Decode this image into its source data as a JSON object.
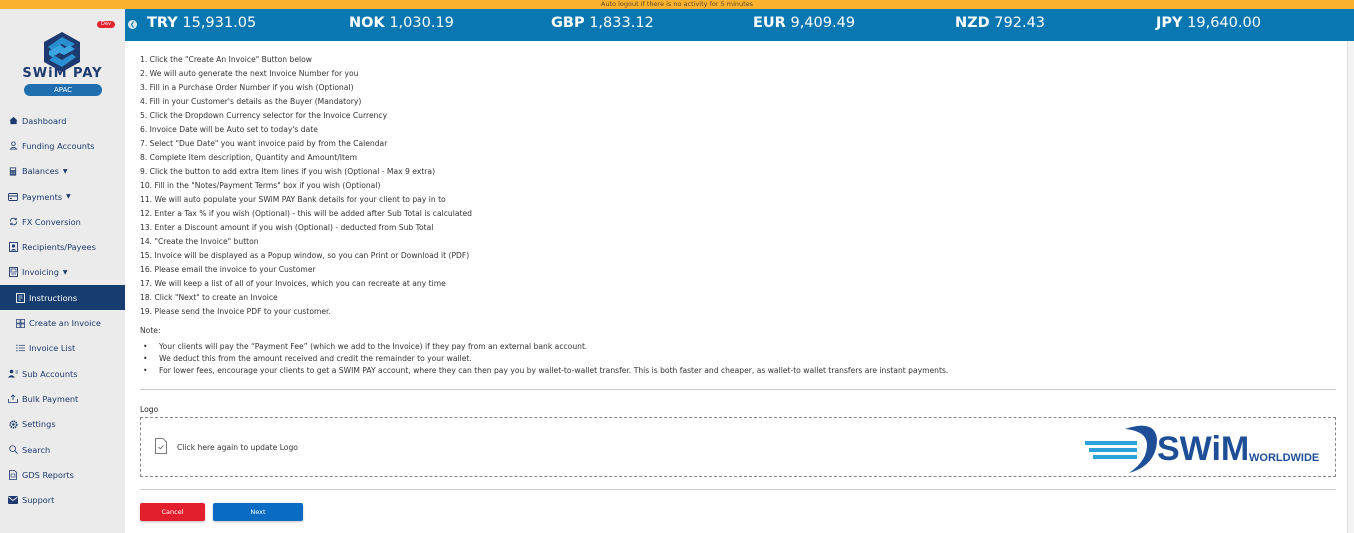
{
  "topbar": {
    "message": "Auto logout if there is no activity for 5 minutes"
  },
  "brand": {
    "name": "SWiM PAY",
    "region": "APAC",
    "env_badge": "Dev"
  },
  "colors": {
    "topbar": "#fbb22e",
    "ticker": "#0977b1",
    "sidebar_active": "#163d6e",
    "cancel": "#e31f2e",
    "next": "#0a6bc2"
  },
  "sidebar": {
    "items": [
      {
        "label": "Dashboard",
        "icon": "home-icon"
      },
      {
        "label": "Funding Accounts",
        "icon": "user-icon"
      },
      {
        "label": "Balances",
        "icon": "calculator-icon",
        "caret": "▼"
      },
      {
        "label": "Payments",
        "icon": "credit-card-icon",
        "caret": "▼"
      },
      {
        "label": "FX Conversion",
        "icon": "refresh-icon"
      },
      {
        "label": "Recipients/Payees",
        "icon": "contact-card-icon"
      },
      {
        "label": "Invoicing",
        "icon": "invoice-icon",
        "caret": "▼"
      },
      {
        "label": "Instructions",
        "icon": "document-icon",
        "sub": true,
        "active": true
      },
      {
        "label": "Create an Invoice",
        "icon": "grid-icon",
        "sub": true
      },
      {
        "label": "Invoice List",
        "icon": "list-icon",
        "sub": true
      },
      {
        "label": "Sub Accounts",
        "icon": "users-icon"
      },
      {
        "label": "Bulk Payment",
        "icon": "upload-icon"
      },
      {
        "label": "Settings",
        "icon": "gear-icon"
      },
      {
        "label": "Search",
        "icon": "search-icon"
      },
      {
        "label": "GDS Reports",
        "icon": "report-icon"
      },
      {
        "label": "Support",
        "icon": "envelope-icon"
      }
    ]
  },
  "ticker": {
    "rates": [
      {
        "code": "TRY",
        "value": "15,931.05"
      },
      {
        "code": "NOK",
        "value": "1,030.19"
      },
      {
        "code": "GBP",
        "value": "1,833.12"
      },
      {
        "code": "EUR",
        "value": "9,409.49"
      },
      {
        "code": "NZD",
        "value": "792.43"
      },
      {
        "code": "JPY",
        "value": "19,640.00"
      }
    ]
  },
  "instructions": {
    "steps": [
      "1. Click the \"Create An Invoice\" Button below",
      "2. We will auto generate the next Invoice Number for you",
      "3. Fill in a Purchase Order Number if you wish (Optional)",
      "4. Fill in your Customer's details as the Buyer (Mandatory)",
      "5. Click the Dropdown Currency selector for the Invoice Currency",
      "6. Invoice Date will be Auto set to today's date",
      "7. Select \"Due Date\" you want invoice paid by from the Calendar",
      "8. Complete Item description, Quantity and Amount/Item",
      "9. Click the button to add extra Item lines if you wish (Optional - Max 9 extra)",
      "10. Fill in the \"Notes/Payment Terms\" box if you wish (Optional)",
      "11. We will auto populate your SWiM PAY Bank details for your client to pay in to",
      "12. Enter a Tax % if you wish (Optional) - this will be added after Sub Total is calculated",
      "13. Enter a Discount amount if you wish (Optional) - deducted from Sub Total",
      "14. \"Create the Invoice\" button",
      "15. Invoice will be displayed as a Popup window, so you can Print or Download it (PDF)",
      "16. Please email the invoice to your Customer",
      "17. We will keep a list of all of your Invoices, which you can recreate at any time",
      "18. Click \"Next\" to create an Invoice",
      "19. Please send the Invoice PDF to your customer."
    ],
    "note_title": "Note:",
    "notes": [
      "Your clients will pay the “Payment Fee” (which we add to the Invoice) if they pay from an external bank account.",
      "We deduct this from the amount received and credit the remainder to your wallet.",
      "For lower fees, encourage your clients to get a SWIM PAY account, where they can then pay you by wallet-to-wallet transfer. This is both faster and cheaper, as wallet-to wallet transfers are instant payments."
    ]
  },
  "logo_section": {
    "label": "Logo",
    "dropzone_text": "Click here again to update Logo",
    "uploaded_logo": {
      "name": "SWiM",
      "suffix": "WORLDWIDE"
    }
  },
  "actions": {
    "cancel_label": "Cancel",
    "next_label": "Next"
  }
}
